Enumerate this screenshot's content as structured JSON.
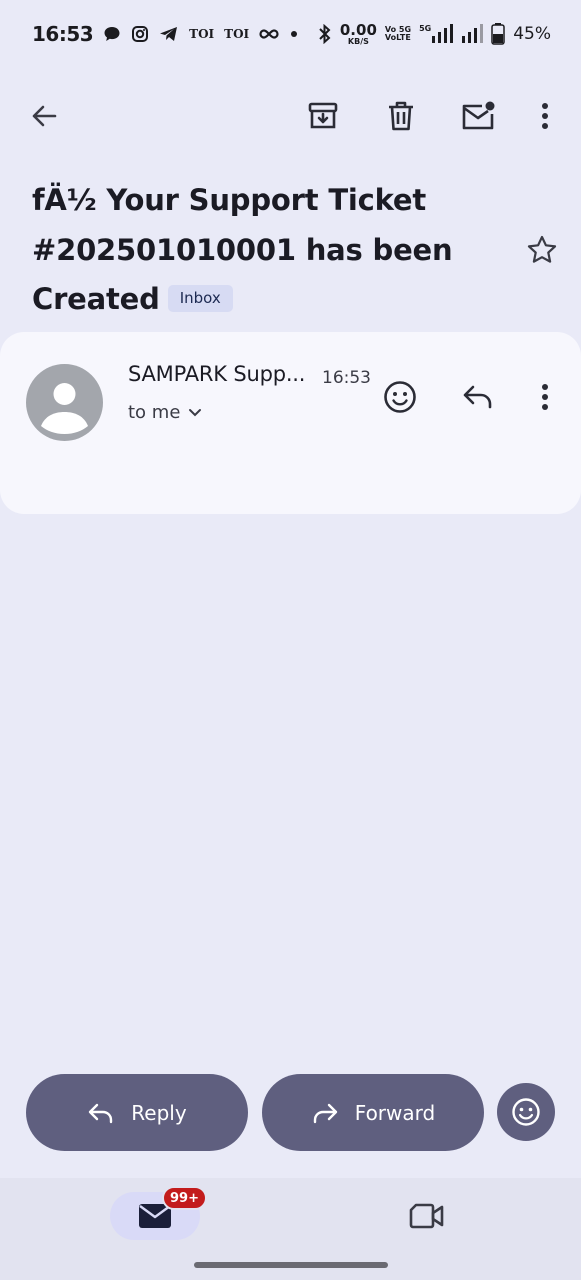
{
  "status_bar": {
    "time": "16:53",
    "toi1": "TOI",
    "toi2": "TOI",
    "speed_value": "0.00",
    "speed_unit": "KB/S",
    "volte_line1": "Vo 5G",
    "volte_line2": "VoLTE",
    "network": "5G",
    "battery": "45%"
  },
  "toolbar": {
    "icons": [
      "back-arrow-icon",
      "archive-icon",
      "delete-icon",
      "mark-unread-icon",
      "more-vert-icon"
    ]
  },
  "email": {
    "subject": "fÄ½ Your Support Ticket #202501010001 has been Created",
    "label_chip": "Inbox",
    "sender": "SAMPARK Supp...",
    "time": "16:53",
    "recipient": "to me"
  },
  "actions": {
    "reply_label": "Reply",
    "forward_label": "Forward"
  },
  "bottom_nav": {
    "mail_badge": "99+",
    "items": [
      "mail-icon",
      "video-meet-icon"
    ]
  },
  "colors": {
    "background": "#e9eaf7",
    "card": "#f7f7fd",
    "button": "#5f5f7f",
    "chip": "#d7dbf3",
    "badge": "#c31c1c"
  }
}
